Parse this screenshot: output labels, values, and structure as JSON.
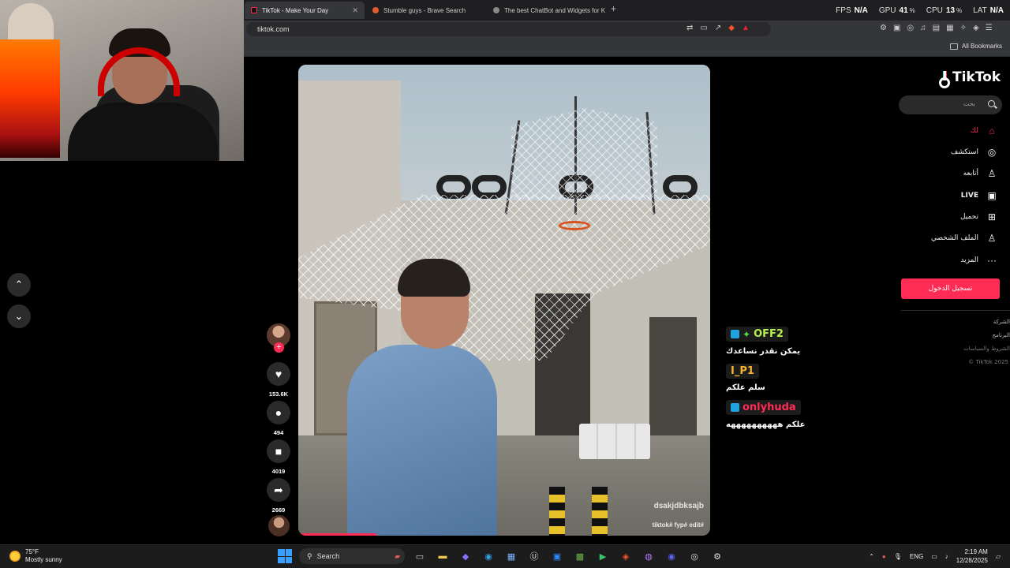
{
  "browser": {
    "tabs": [
      {
        "title": "TikTok - Make Your Day",
        "active": true
      },
      {
        "title": "Stumble guys - Brave Search",
        "active": false
      },
      {
        "title": "The best ChatBot and Widgets for K",
        "active": false
      }
    ],
    "new_tab": "+",
    "url": "tiktok.com",
    "bookmarks_label": "All Bookmarks",
    "stats": [
      {
        "label": "FPS",
        "value": "N/A",
        "unit": ""
      },
      {
        "label": "GPU",
        "value": "41",
        "unit": "%"
      },
      {
        "label": "CPU",
        "value": "13",
        "unit": "%"
      },
      {
        "label": "LAT",
        "value": "N/A",
        "unit": ""
      }
    ]
  },
  "video": {
    "watermark": "dsakjdbksajb",
    "caption": "tiktok# fyp# edit#",
    "progress_fraction": 0.19
  },
  "actions": {
    "likes": "153.6K",
    "comments": "494",
    "saves": "4019",
    "shares": "2669"
  },
  "chat": [
    {
      "user": "OFF2",
      "text": "يمكن نقدر نساعدك"
    },
    {
      "user": "I_P1",
      "text": "سلم علكم"
    },
    {
      "user": "onlyhuda",
      "text": "علكم ههههههههههه"
    }
  ],
  "sidebar": {
    "logo": "TikTok",
    "search_placeholder": "بحث",
    "nav": [
      {
        "label": "لك",
        "icon": "home-icon"
      },
      {
        "label": "استكشف",
        "icon": "compass-icon"
      },
      {
        "label": "أتابعه",
        "icon": "user-follow-icon"
      },
      {
        "label": "LIVE",
        "icon": "live-icon"
      },
      {
        "label": "تحميل",
        "icon": "upload-icon"
      },
      {
        "label": "الملف الشخصي",
        "icon": "profile-icon"
      },
      {
        "label": "المزيد",
        "icon": "more-icon"
      }
    ],
    "login_label": "تسجيل الدخول",
    "footer": [
      "الشركة",
      "البرنامج",
      "الشروط والسياسات",
      "TikTok 2025 ©"
    ]
  },
  "taskbar": {
    "weather_temp": "75°F",
    "weather_desc": "Mostly sunny",
    "search_label": "Search",
    "language": "ENG",
    "time": "2:19 AM",
    "date": "12/28/2025"
  },
  "colors": {
    "tiktok_red": "#fe2c55",
    "tiktok_cyan": "#25f4ee",
    "chat_off2": "#b6f24a",
    "chat_ip1": "#f5b42a",
    "chat_onlyhuda": "#fe2c55"
  }
}
